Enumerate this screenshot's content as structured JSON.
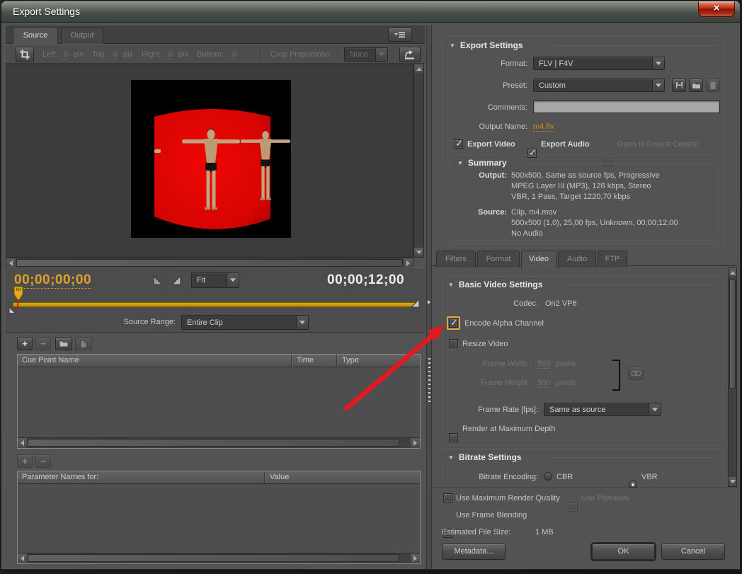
{
  "window": {
    "title": "Export Settings",
    "close_glyph": "×"
  },
  "colors": {
    "accent_orange": "#E8A33D",
    "link_orange": "#CF8A2B",
    "timeline_gold": "#C99702",
    "arrow_red": "#DF1B21",
    "timecode_orange": "#DFA02A"
  },
  "source_panel": {
    "tabs": [
      {
        "label": "Source"
      },
      {
        "label": "Output"
      }
    ],
    "crop": {
      "fields": [
        {
          "label": "Left:",
          "value": "0",
          "unit": "pix"
        },
        {
          "label": "Top:",
          "value": "0",
          "unit": "pix"
        },
        {
          "label": "Right:",
          "value": "0",
          "unit": "pix"
        },
        {
          "label": "Bottom:",
          "value": "0",
          "unit": ""
        }
      ],
      "proportions_label": "Crop Proportions:",
      "proportions_value": "None"
    },
    "transport": {
      "current_time": "00;00;00;00",
      "zoom_value": "Fit",
      "duration": "00;00;12;00"
    },
    "source_range": {
      "label": "Source Range:",
      "value": "Entire Clip"
    },
    "cue_points": {
      "headers": {
        "name": "Cue Point Name",
        "time": "Time",
        "type": "Type"
      },
      "rows": []
    },
    "parameters": {
      "headers": {
        "name": "Parameter Names for:",
        "value": "Value"
      },
      "rows": []
    }
  },
  "export_panel": {
    "settings": {
      "title": "Export Settings",
      "format_label": "Format:",
      "format_value": "FLV | F4V",
      "preset_label": "Preset:",
      "preset_value": "Custom",
      "comments_label": "Comments:",
      "comments_value": "",
      "output_name_label": "Output Name:",
      "output_name_value": "m4.flv",
      "export_video_label": "Export Video",
      "export_video_checked": true,
      "export_audio_label": "Export Audio",
      "export_audio_checked": true,
      "open_device_central_label": "Open in Device Central",
      "open_device_central_enabled": false
    },
    "summary": {
      "title": "Summary",
      "output_label": "Output:",
      "output_lines": [
        "500x500, Same as source fps, Progressive",
        "MPEG Layer III (MP3), 128 kbps, Stereo",
        "VBR, 1 Pass, Target 1220,70 kbps"
      ],
      "source_label": "Source:",
      "source_lines": [
        "Clip, m4.mov",
        "500x500 (1,0), 25,00 fps, Unknown, 00;00;12;00",
        "No Audio"
      ]
    },
    "tabs": [
      {
        "label": "Filters",
        "active": false
      },
      {
        "label": "Format",
        "active": false
      },
      {
        "label": "Video",
        "active": true
      },
      {
        "label": "Audio",
        "active": false
      },
      {
        "label": "FTP",
        "active": false
      }
    ],
    "video_tab": {
      "basic_title": "Basic Video Settings",
      "codec_label": "Codec:",
      "codec_value": "On2 VP6",
      "encode_alpha_label": "Encode Alpha Channel",
      "encode_alpha_checked": true,
      "resize_video_label": "Resize Video",
      "resize_video_checked": false,
      "frame_width_label": "Frame Width :",
      "frame_width_value": "500",
      "frame_width_unit": "pixels",
      "frame_height_label": "Frame Height :",
      "frame_height_value": "500",
      "frame_height_unit": "pixels",
      "frame_rate_label": "Frame Rate [fps]:",
      "frame_rate_value": "Same as source",
      "render_max_depth_label": "Render at Maximum Depth",
      "bitrate_title": "Bitrate Settings",
      "bitrate_encoding_label": "Bitrate Encoding:",
      "bitrate_options": [
        {
          "label": "CBR",
          "selected": false
        },
        {
          "label": "VBR",
          "selected": true
        }
      ]
    },
    "footer": {
      "use_max_render_quality": "Use Maximum Render Quality",
      "use_previews": "Use Previews",
      "use_frame_blending": "Use Frame Blending",
      "estimated_file_size_label": "Estimated File Size:",
      "estimated_file_size_value": "1 MB",
      "metadata_button": "Metadata...",
      "ok_button": "OK",
      "cancel_button": "Cancel"
    }
  }
}
